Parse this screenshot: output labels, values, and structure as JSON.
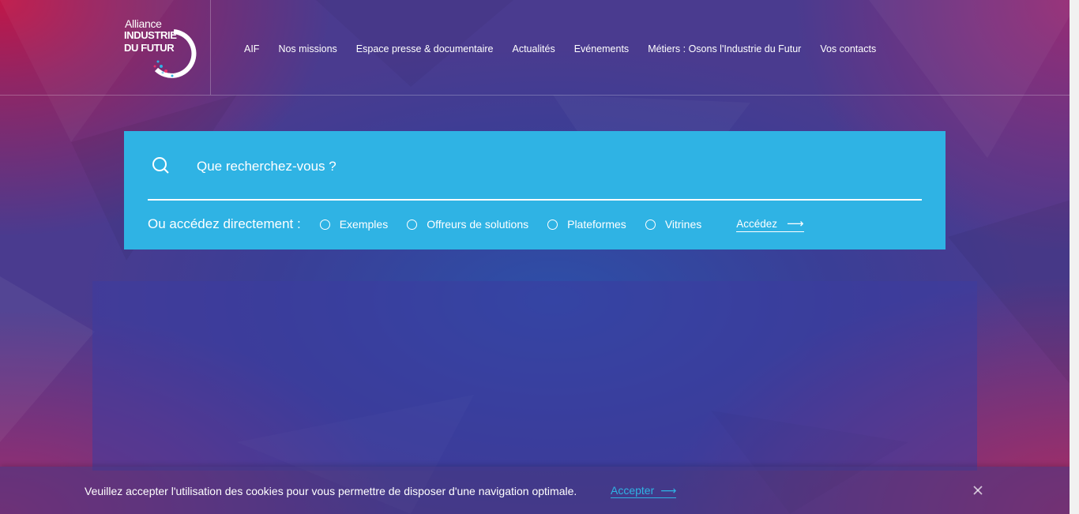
{
  "logo": {
    "line1": "Alliance",
    "line2": "INDUSTRIE",
    "line3": "DU FUTUR"
  },
  "nav": {
    "items": [
      {
        "label": "AIF"
      },
      {
        "label": "Nos missions"
      },
      {
        "label": "Espace presse & documentaire"
      },
      {
        "label": "Actualités"
      },
      {
        "label": "Evénements"
      },
      {
        "label": "Métiers : Osons l'Industrie du Futur"
      },
      {
        "label": "Vos contacts"
      }
    ]
  },
  "search": {
    "placeholder": "Que recherchez-vous ?",
    "access_label": "Ou accédez directement :",
    "options": [
      {
        "label": "Exemples"
      },
      {
        "label": "Offreurs de solutions"
      },
      {
        "label": "Plateformes"
      },
      {
        "label": "Vitrines"
      }
    ],
    "access_link": "Accédez",
    "accent_color": "#2fb3e4"
  },
  "cookie": {
    "text": "Veuillez accepter l'utilisation des cookies pour vous permettre de disposer d'une navigation optimale.",
    "accept_label": "Accepter"
  },
  "icons": [
    "search-icon",
    "arrow-right-icon",
    "close-icon",
    "logo-ring-icon"
  ]
}
